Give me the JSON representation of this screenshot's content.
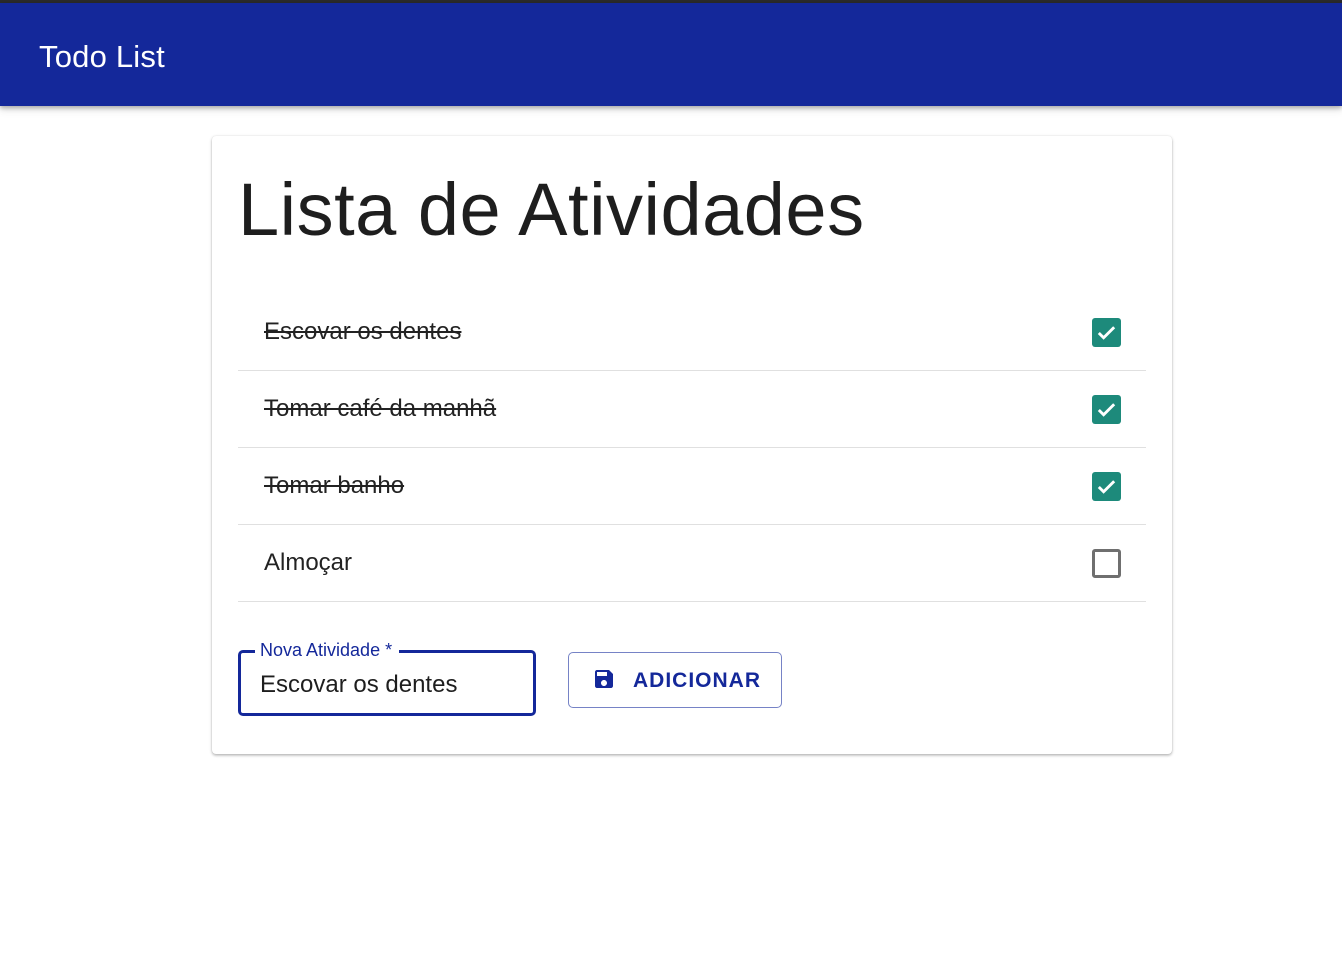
{
  "appbar": {
    "title": "Todo List"
  },
  "card": {
    "title": "Lista de Atividades"
  },
  "todos": [
    {
      "label": "Escovar os dentes",
      "done": true
    },
    {
      "label": "Tomar café da manhã",
      "done": true
    },
    {
      "label": "Tomar banho",
      "done": true
    },
    {
      "label": "Almoçar",
      "done": false
    }
  ],
  "form": {
    "field_label": "Nova Atividade *",
    "field_value": "Escovar os dentes",
    "add_button_label": "ADICIONAR",
    "add_button_icon": "save-icon"
  },
  "colors": {
    "primary": "#14289a",
    "checkbox_checked": "#1d8a7b",
    "checkbox_unchecked_border": "#6f6f6f"
  }
}
